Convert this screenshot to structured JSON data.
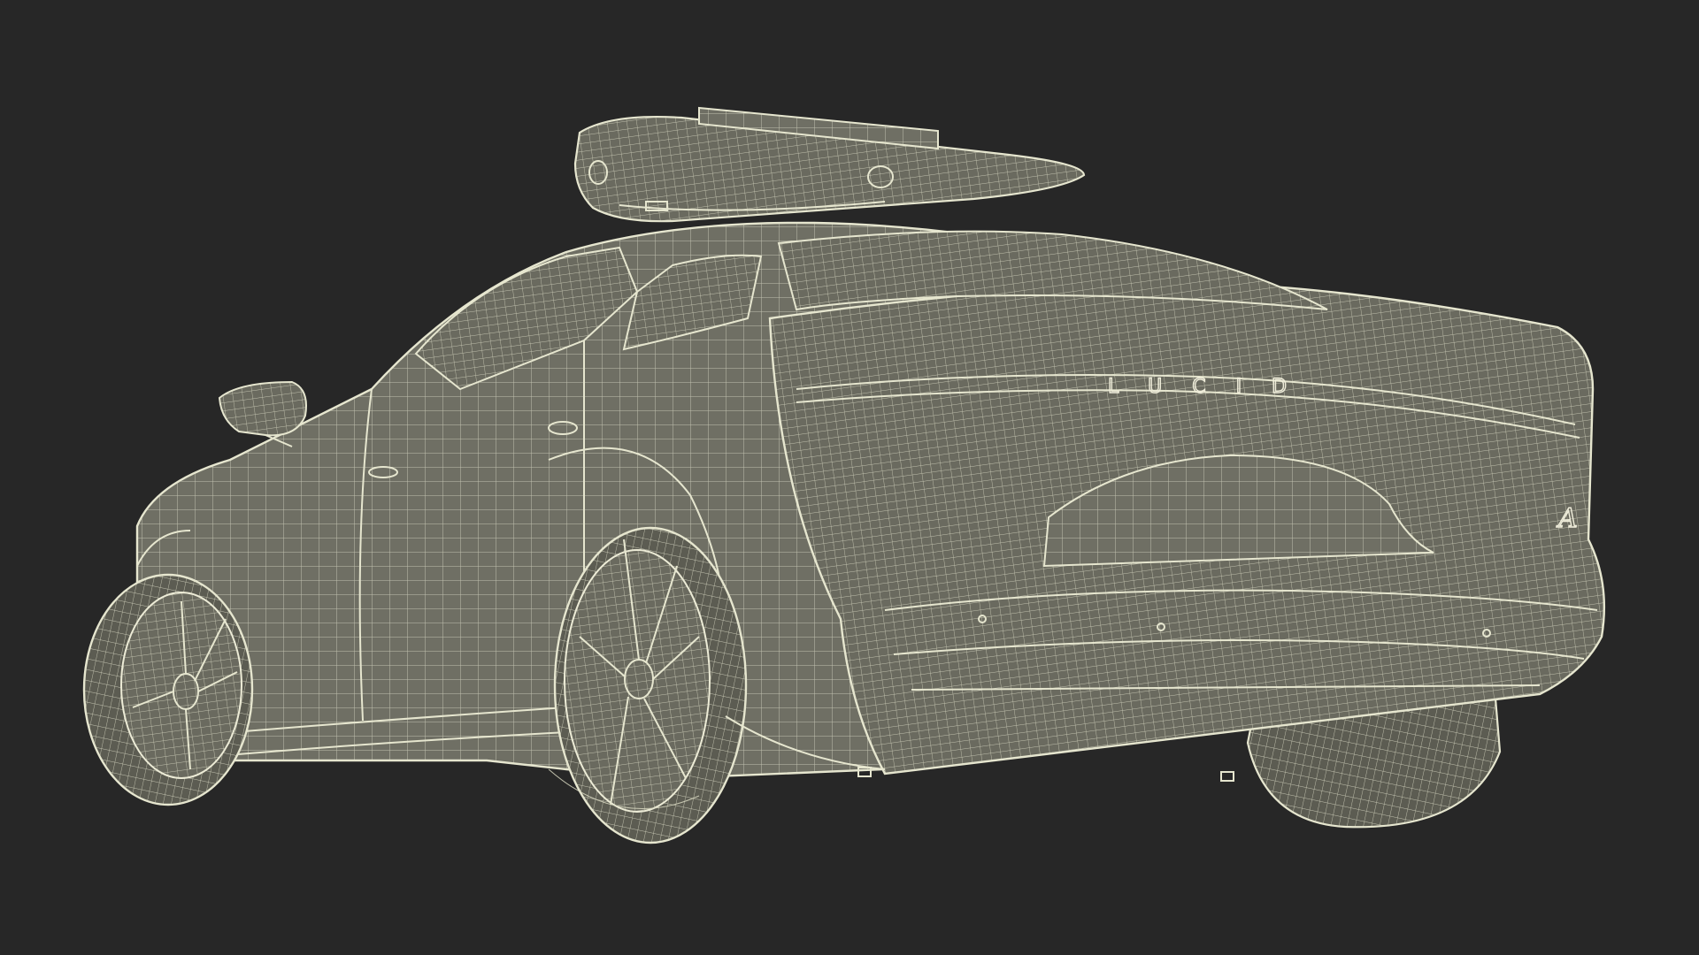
{
  "scene": {
    "subject": "car-wireframe-render",
    "background_color": "#272727",
    "mesh_fill_color": "#6f6f64",
    "wire_color": "#e6e6cf"
  },
  "branding": {
    "rear_lettering": "LUCID",
    "emblem": "A"
  }
}
